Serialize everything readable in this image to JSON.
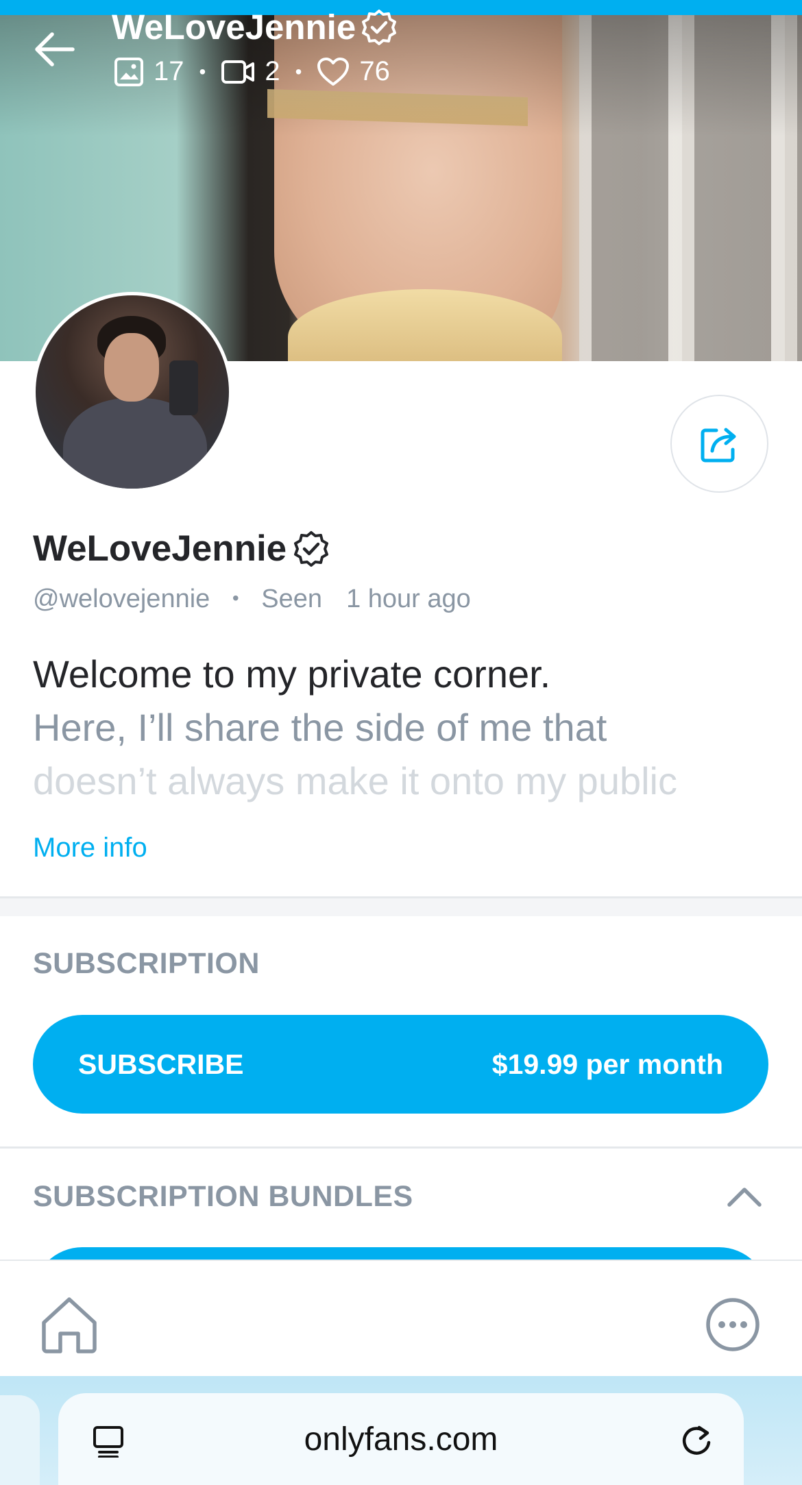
{
  "header": {
    "title": "WeLoveJennie",
    "stats": {
      "photos": "17",
      "videos": "2",
      "likes": "76"
    }
  },
  "profile": {
    "name": "WeLoveJennie",
    "handle": "@welovejennie",
    "seen_label": "Seen",
    "seen_time": "1 hour ago",
    "bio_line1": "Welcome to my private corner.",
    "bio_line2": "Here, I’ll share the side of me that",
    "bio_line3": "doesn’t always make it onto my public",
    "more_info": "More info"
  },
  "subscription": {
    "section_title": "SUBSCRIPTION",
    "button_label": "SUBSCRIBE",
    "price": "$19.99 per month"
  },
  "bundles": {
    "section_title": "SUBSCRIPTION BUNDLES"
  },
  "browser": {
    "url": "onlyfans.com"
  },
  "colors": {
    "accent": "#00aff0",
    "text": "#242529",
    "muted": "#8a96a3"
  }
}
